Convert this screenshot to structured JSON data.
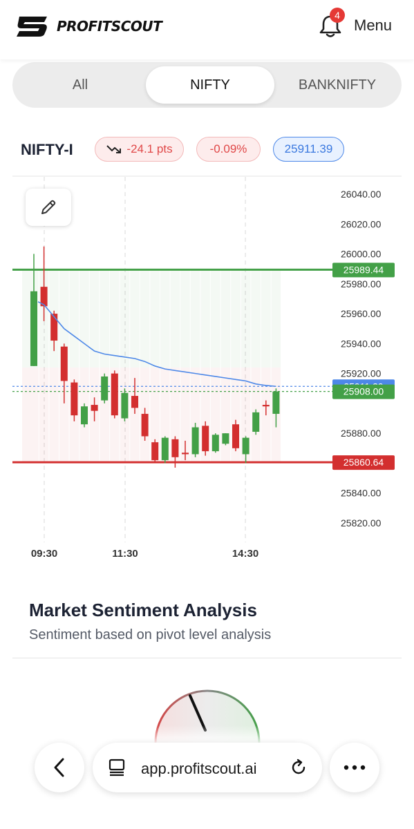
{
  "header": {
    "brand": "PROFITSCOUT",
    "notification_count": "4",
    "menu_label": "Menu"
  },
  "tabs": [
    {
      "label": "All",
      "active": false
    },
    {
      "label": "NIFTY",
      "active": true
    },
    {
      "label": "BANKNIFTY",
      "active": false
    }
  ],
  "symbol": {
    "name": "NIFTY-I",
    "change_points": "-24.1 pts",
    "change_percent": "-0.09%",
    "last_price": "25911.39"
  },
  "chart_data": {
    "type": "candlestick",
    "x_tick_labels": [
      "09:30",
      "11:30",
      "14:30"
    ],
    "y_tick_labels": [
      "26040.00",
      "26020.00",
      "26000.00",
      "25980.00",
      "25960.00",
      "25940.00",
      "25920.00",
      "25880.00",
      "25840.00",
      "25820.00"
    ],
    "ylim": [
      25810,
      26050
    ],
    "grid": "vertical dashed lines at x ticks",
    "levels": [
      {
        "label": "25989.44",
        "value": 25989.44,
        "color": "#43a047"
      },
      {
        "label": "25911.39",
        "value": 25911.39,
        "color": "#4d88e8"
      },
      {
        "label": "25908.00",
        "value": 25908.0,
        "color": "#43a047"
      },
      {
        "label": "25860.64",
        "value": 25860.64,
        "color": "#d32f2f"
      }
    ],
    "candles": [
      [
        25925,
        25975,
        26000,
        25925
      ],
      [
        25978,
        25965,
        26005,
        25955
      ],
      [
        25960,
        25942,
        25962,
        25935
      ],
      [
        25938,
        25915,
        25940,
        25900
      ],
      [
        25914,
        25892,
        25916,
        25888
      ],
      [
        25886,
        25898,
        25900,
        25884
      ],
      [
        25899,
        25895,
        25904,
        25888
      ],
      [
        25902,
        25918,
        25920,
        25900
      ],
      [
        25920,
        25892,
        25922,
        25890
      ],
      [
        25890,
        25907,
        25910,
        25888
      ],
      [
        25905,
        25897,
        25917,
        25893
      ],
      [
        25893,
        25878,
        25897,
        25875
      ],
      [
        25874,
        25862,
        25876,
        25860
      ],
      [
        25862,
        25877,
        25878,
        25860
      ],
      [
        25876,
        25864,
        25878,
        25857
      ],
      [
        25867,
        25866,
        25875,
        25862
      ],
      [
        25866,
        25884,
        25887,
        25864
      ],
      [
        25885,
        25868,
        25888,
        25865
      ],
      [
        25868,
        25879,
        25880,
        25867
      ],
      [
        25873,
        25880,
        25880,
        25872
      ],
      [
        25886,
        25870,
        25889,
        25868
      ],
      [
        25866,
        25877,
        25878,
        25860
      ],
      [
        25881,
        25894,
        25896,
        25879
      ],
      [
        25899,
        25898,
        25902,
        25892
      ],
      [
        25893,
        25908,
        25910,
        25884
      ]
    ],
    "vwap": [
      25968,
      25966,
      25958,
      25950,
      25945,
      25940,
      25935,
      25933,
      25932,
      25931,
      25930,
      25928,
      25925,
      25923,
      25922,
      25921,
      25920,
      25919,
      25918,
      25917,
      25916,
      25915,
      25913,
      25912,
      25911.39
    ]
  },
  "sentiment": {
    "title": "Market Sentiment Analysis",
    "subtitle": "Sentiment based on pivot level analysis"
  },
  "browser": {
    "url": "app.profitscout.ai"
  },
  "colors": {
    "up": "#43a047",
    "down": "#d32f2f",
    "vwap": "#4d88e8",
    "accent": "#4d88e8"
  }
}
